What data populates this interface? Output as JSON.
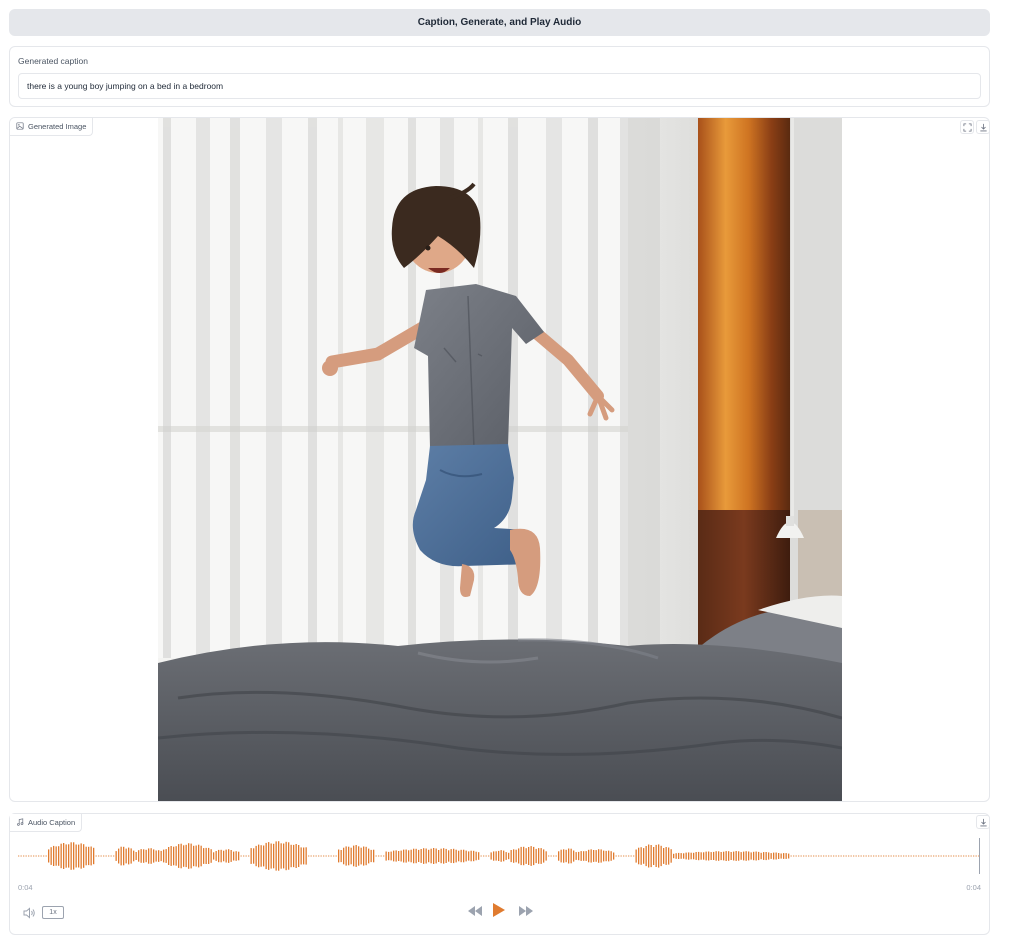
{
  "button": {
    "label": "Caption, Generate, and Play Audio"
  },
  "caption": {
    "label": "Generated caption",
    "value": "there is a young boy jumping on a bed in a bedroom"
  },
  "image_block": {
    "label": "Generated Image"
  },
  "audio_block": {
    "label": "Audio Caption",
    "current_time": "0:04",
    "duration": "0:04",
    "playback_rate": "1x",
    "played_fraction": 0
  },
  "colors": {
    "accent": "#e07b2f",
    "border": "#e5e7eb",
    "muted": "#9ca3af"
  }
}
